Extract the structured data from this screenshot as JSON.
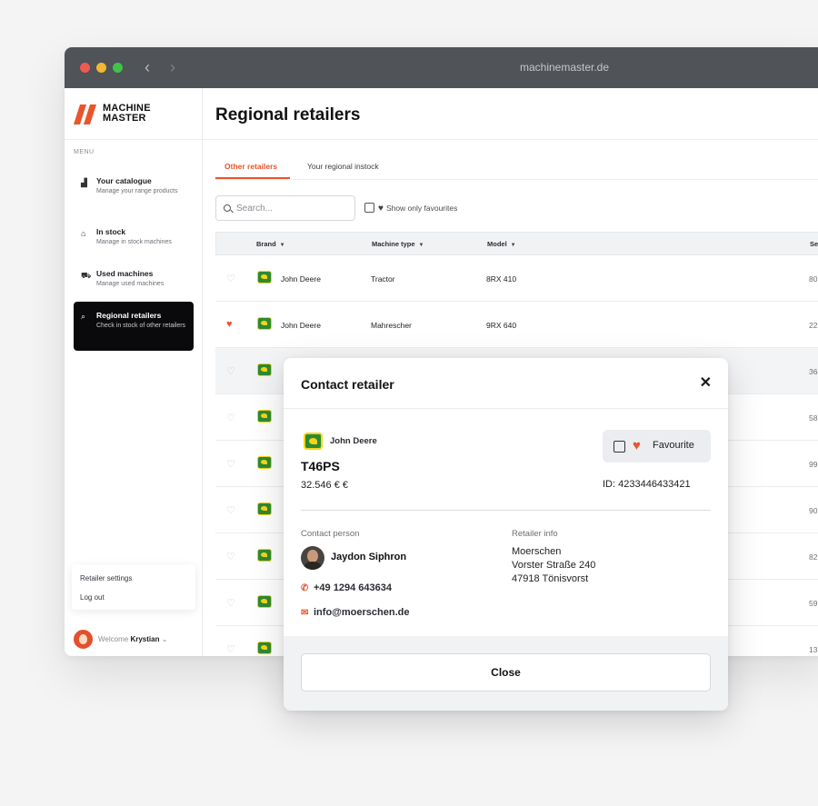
{
  "browser": {
    "url": "machinemaster.de",
    "back_icon": "‹",
    "forward_icon": "›"
  },
  "logo": {
    "line1": "MACHINE",
    "line2": "MASTER",
    "color": "#e8552c"
  },
  "sidebar": {
    "menu_label": "MENU",
    "items": [
      {
        "title": "Your catalogue",
        "subtitle": "Manage your range products",
        "icon": "catalogue-icon",
        "glyph": "▟"
      },
      {
        "title": "In stock",
        "subtitle": "Manage in stock machines",
        "icon": "warehouse-icon",
        "glyph": "⌂"
      },
      {
        "title": "Used machines",
        "subtitle": "Manage used machines",
        "icon": "tractor-icon",
        "glyph": "⛟"
      },
      {
        "title": "Regional retailers",
        "subtitle": "Check in stock of other retailers",
        "icon": "search-icon",
        "glyph": "⌕"
      }
    ],
    "settings": {
      "retailer_settings": "Retailer settings",
      "log_out": "Log out"
    },
    "user": {
      "welcome": "Welcome",
      "name": "Krystian",
      "chevron": "⌄"
    }
  },
  "page": {
    "title": "Regional retailers",
    "tabs": [
      {
        "label": "Other retailers"
      },
      {
        "label": "Your regional instock"
      }
    ],
    "search_placeholder": "Search...",
    "show_favourites": "Show only favourites"
  },
  "table": {
    "columns": {
      "brand": "Brand",
      "machine_type": "Machine type",
      "model": "Model",
      "serial": "Se"
    },
    "rows": [
      {
        "brand": "John Deere",
        "type": "Tractor",
        "model": "8RX 410",
        "serial": "80",
        "fav": false
      },
      {
        "brand": "John Deere",
        "type": "Mahrescher",
        "model": "9RX 640",
        "serial": "22",
        "fav": true
      },
      {
        "brand": "",
        "type": "",
        "model": "",
        "serial": "36",
        "fav": false
      },
      {
        "brand": "",
        "type": "",
        "model": "",
        "serial": "58",
        "fav": false
      },
      {
        "brand": "",
        "type": "",
        "model": "",
        "serial": "99",
        "fav": false
      },
      {
        "brand": "",
        "type": "",
        "model": "",
        "serial": "90",
        "fav": false
      },
      {
        "brand": "",
        "type": "",
        "model": "",
        "serial": "82",
        "fav": false
      },
      {
        "brand": "",
        "type": "",
        "model": "",
        "serial": "59",
        "fav": false
      },
      {
        "brand": "",
        "type": "",
        "model": "",
        "serial": "13",
        "fav": false
      }
    ]
  },
  "modal": {
    "title": "Contact retailer",
    "close_icon": "✕",
    "brand": "John Deere",
    "model": "T46PS",
    "price": "32.546 € €",
    "favourite_label": "Favourite",
    "id_text": "ID: 4233446433421",
    "contact_person_label": "Contact person",
    "retailer_info_label": "Retailer info",
    "person_name": "Jaydon Siphron",
    "phone": "+49 1294 643634",
    "email": "info@moerschen.de",
    "address": [
      "Moerschen",
      "Vorster Straße 240",
      "47918 Tönisvorst"
    ],
    "close_button": "Close"
  },
  "colors": {
    "accent": "#e8552c",
    "dark": "#0a0a0c",
    "jd_green": "#2d8a34",
    "jd_yellow": "#f7d417"
  }
}
